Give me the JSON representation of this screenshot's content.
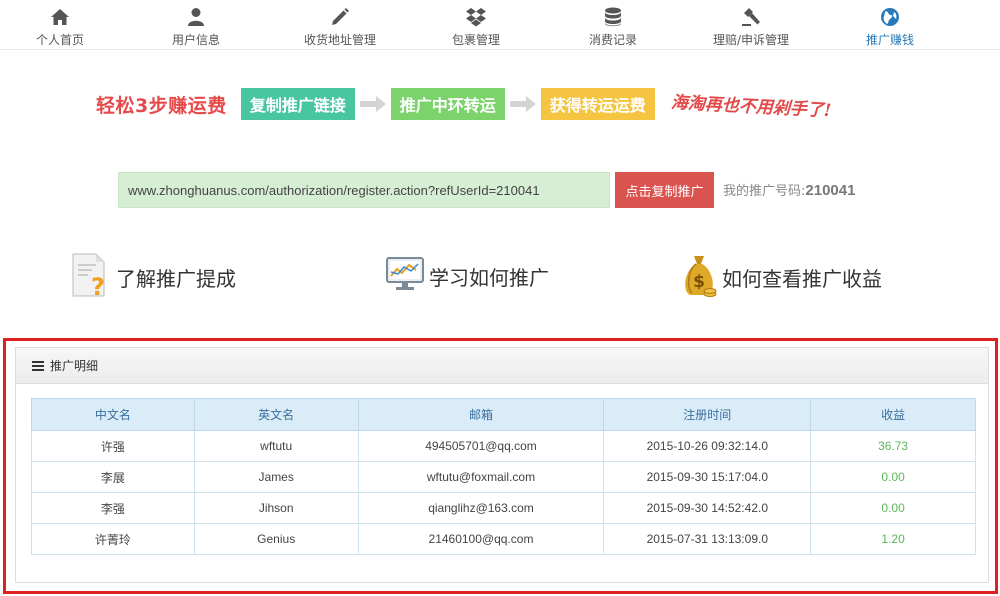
{
  "nav": {
    "items": [
      {
        "label": "个人首页",
        "icon": "home-icon"
      },
      {
        "label": "用户信息",
        "icon": "user-icon"
      },
      {
        "label": "收货地址管理",
        "icon": "pencil-icon"
      },
      {
        "label": "包裹管理",
        "icon": "dropbox-icon"
      },
      {
        "label": "消费记录",
        "icon": "database-icon"
      },
      {
        "label": "理赔/申诉管理",
        "icon": "gavel-icon"
      },
      {
        "label": "推广赚钱",
        "icon": "globe-icon",
        "active": true
      }
    ]
  },
  "steps": {
    "title": "轻松3步赚运费",
    "step1": "复制推广链接",
    "step2": "推广中环转运",
    "step3": "获得转运运费",
    "slogan": "海淘再也不用剁手了!"
  },
  "promo": {
    "link": "www.zhonghuanus.com/authorization/register.action?refUserId=210041",
    "copy_button": "点击复制推广",
    "code_label": "我的推广号码:",
    "code": "210041"
  },
  "help": {
    "learn_commission": "了解推广提成",
    "learn_promote": "学习如何推广",
    "view_earnings": "如何查看推广收益"
  },
  "details": {
    "title": "推广明细",
    "columns": [
      "中文名",
      "英文名",
      "邮箱",
      "注册时间",
      "收益"
    ],
    "rows": [
      [
        "许强",
        "wftutu",
        "494505701@qq.com",
        "2015-10-26 09:32:14.0",
        "36.73"
      ],
      [
        "李展",
        "James",
        "wftutu@foxmail.com",
        "2015-09-30 15:17:04.0",
        "0.00"
      ],
      [
        "李强",
        "Jihson",
        "qianglihz@163.com",
        "2015-09-30 14:52:42.0",
        "0.00"
      ],
      [
        "许菁玲",
        "Genius",
        "21460100@qq.com",
        "2015-07-31 13:13:09.0",
        "1.20"
      ]
    ]
  },
  "colors": {
    "accent_blue": "#2a7ab8",
    "step1": "#47c6a0",
    "step2": "#7cd36c",
    "step3": "#f5c542",
    "copy_button": "#d9534f",
    "highlight_frame": "#e02020",
    "earnings_green": "#5cb85c"
  }
}
